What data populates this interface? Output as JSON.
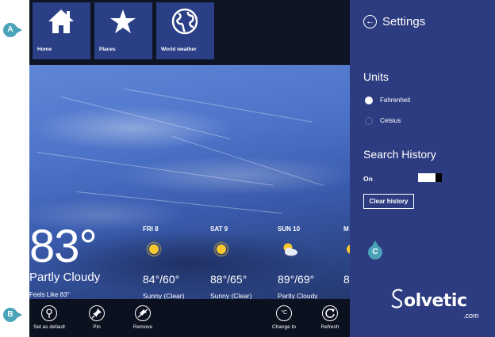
{
  "callouts": {
    "a": "A",
    "b": "B",
    "c": "C"
  },
  "nav": {
    "tiles": [
      {
        "label": "Home",
        "icon": "home-icon"
      },
      {
        "label": "Places",
        "icon": "star-icon"
      },
      {
        "label": "World weather",
        "icon": "globe-icon"
      }
    ]
  },
  "current": {
    "temperature": "83°",
    "condition": "Partly Cloudy",
    "feels_like": "Feels Like 83°"
  },
  "forecast": [
    {
      "day": "FRI 8",
      "temps": "84°/60°",
      "condition": "Sunny (Clear)",
      "icon": "sun-icon"
    },
    {
      "day": "SAT 9",
      "temps": "88°/65°",
      "condition": "Sunny (Clear)",
      "icon": "sun-icon"
    },
    {
      "day": "SUN 10",
      "temps": "89°/69°",
      "condition": "Partly Cloudy",
      "icon": "partly-cloudy-icon"
    },
    {
      "day": "M",
      "temps": "8",
      "condition": "",
      "icon": "sun-icon"
    }
  ],
  "appbar": {
    "set_default": "Set as default",
    "pin": "Pin",
    "remove": "Remove",
    "change_to": "Change to",
    "refresh": "Refresh",
    "change_symbol": "°C"
  },
  "settings": {
    "title": "Settings",
    "units_heading": "Units",
    "units": [
      {
        "label": "Fahrenheit",
        "checked": true
      },
      {
        "label": "Celsius",
        "checked": false
      }
    ],
    "history_heading": "Search History",
    "history_toggle_label": "On",
    "history_toggle_on": true,
    "clear_button": "Clear history"
  },
  "watermark": {
    "word": "olvetic",
    "suffix": ".com"
  },
  "colors": {
    "tile": "#2b3f86",
    "settings_panel": "#2d3c80",
    "topbar": "#0e1424",
    "appbar": "#0c1120",
    "callout": "#4aa3b8",
    "sun": "#f6c82c"
  }
}
